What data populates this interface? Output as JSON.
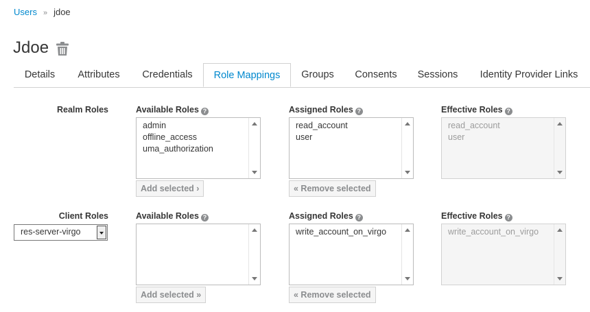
{
  "breadcrumb": {
    "parent": "Users",
    "separator": "»",
    "current": "jdoe"
  },
  "page": {
    "title": "Jdoe"
  },
  "tabs": [
    {
      "label": "Details"
    },
    {
      "label": "Attributes"
    },
    {
      "label": "Credentials"
    },
    {
      "label": "Role Mappings",
      "active": true
    },
    {
      "label": "Groups"
    },
    {
      "label": "Consents"
    },
    {
      "label": "Sessions"
    },
    {
      "label": "Identity Provider Links"
    }
  ],
  "realm": {
    "label": "Realm Roles",
    "available_label": "Available Roles",
    "assigned_label": "Assigned Roles",
    "effective_label": "Effective Roles",
    "available": [
      "admin",
      "offline_access",
      "uma_authorization"
    ],
    "assigned": [
      "read_account",
      "user"
    ],
    "effective": [
      "read_account",
      "user"
    ],
    "add_button": "Add selected ›",
    "remove_button": "« Remove selected"
  },
  "client": {
    "label": "Client Roles",
    "selected_client": "res-server-virgo",
    "available_label": "Available Roles",
    "assigned_label": "Assigned Roles",
    "effective_label": "Effective Roles",
    "available": [],
    "assigned": [
      "write_account_on_virgo"
    ],
    "effective": [
      "write_account_on_virgo"
    ],
    "add_button": "Add selected »",
    "remove_button": "« Remove selected"
  },
  "help_glyph": "?",
  "colors": {
    "link": "#0088ce",
    "text": "#363636",
    "muted": "#8b8d8f"
  }
}
